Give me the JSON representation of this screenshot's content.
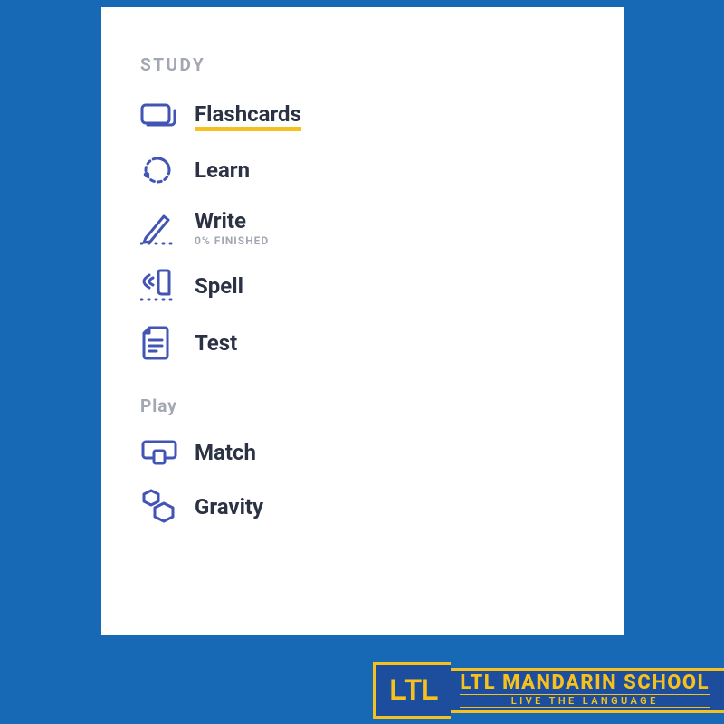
{
  "sidebar": {
    "sections": [
      {
        "header": "STUDY",
        "items": [
          {
            "label": "Flashcards",
            "active": true
          },
          {
            "label": "Learn"
          },
          {
            "label": "Write",
            "sub": "0% FINISHED"
          },
          {
            "label": "Spell"
          },
          {
            "label": "Test"
          }
        ]
      },
      {
        "header": "Play",
        "items": [
          {
            "label": "Match"
          },
          {
            "label": "Gravity"
          }
        ]
      }
    ]
  },
  "footer": {
    "logo": "LTL",
    "title": "LTL MANDARIN SCHOOL",
    "tagline": "LIVE THE LANGUAGE"
  },
  "colors": {
    "background": "#1769b5",
    "accent": "#f6c11e",
    "icon": "#4254b4",
    "text": "#2b3243",
    "muted": "#a2a7b1"
  }
}
